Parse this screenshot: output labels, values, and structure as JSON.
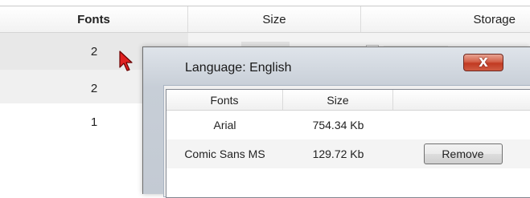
{
  "background": {
    "columns": [
      "Fonts",
      "Size",
      "Storage"
    ],
    "rows": [
      {
        "fonts": "2"
      },
      {
        "fonts": "2"
      },
      {
        "fonts": "1"
      }
    ]
  },
  "dialog": {
    "title": "Language: English",
    "close_label": "X",
    "table": {
      "columns": [
        "Fonts",
        "Size",
        ""
      ],
      "rows": [
        {
          "font": "Arial",
          "size": "754.34 Kb"
        },
        {
          "font": "Comic Sans MS",
          "size": "129.72 Kb",
          "action": "Remove"
        }
      ]
    }
  },
  "colors": {
    "close_button": "#c13a22",
    "dialog_frame": "#c7ced7",
    "cursor": "#e02020"
  },
  "icons": {
    "cursor": "mouse-pointer-icon",
    "close": "close-icon"
  }
}
